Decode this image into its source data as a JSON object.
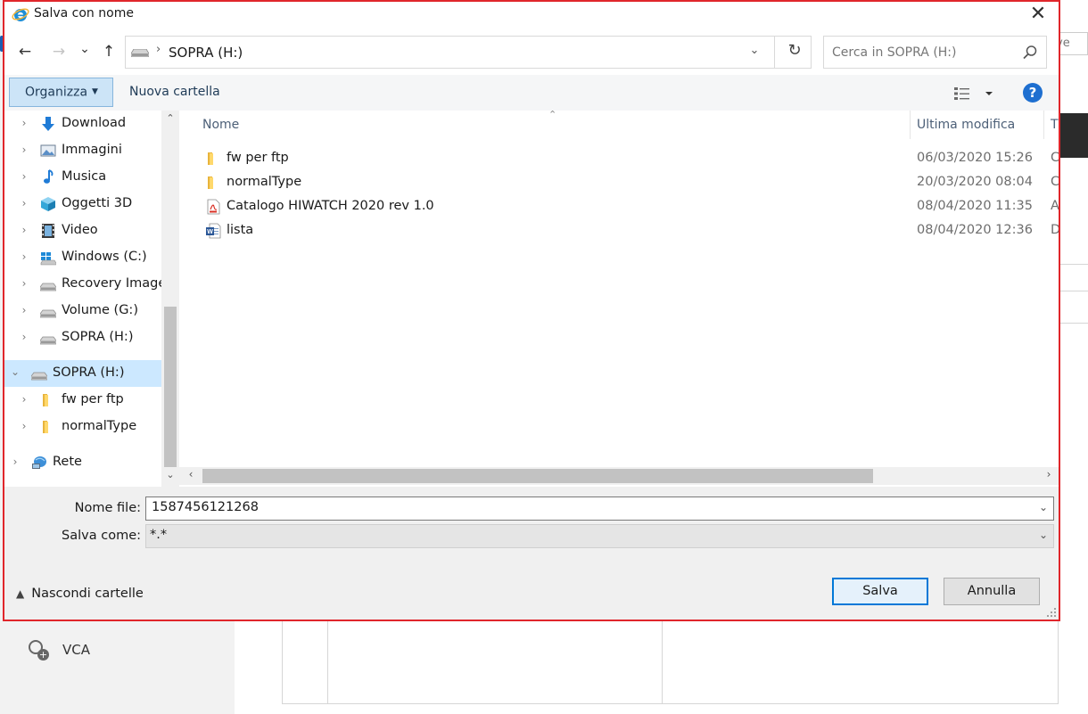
{
  "dialog": {
    "title": "Salva con nome",
    "close_symbol": "✕"
  },
  "nav": {
    "path": "SOPRA (H:)",
    "search_placeholder": "Cerca in SOPRA (H:)",
    "back_symbol": "←",
    "forward_symbol": "→",
    "recent_symbol": "⌄",
    "up_symbol": "↑",
    "dropdown_symbol": "⌄",
    "refresh_symbol": "↻"
  },
  "toolbar": {
    "organize_label": "Organizza",
    "new_folder_label": "Nuova cartella",
    "help_symbol": "?"
  },
  "tree": {
    "items": [
      {
        "label": "Download",
        "icon": "download-icon",
        "expanded": false
      },
      {
        "label": "Immagini",
        "icon": "pictures-icon",
        "expanded": false
      },
      {
        "label": "Musica",
        "icon": "music-icon",
        "expanded": false
      },
      {
        "label": "Oggetti 3D",
        "icon": "3d-objects-icon",
        "expanded": false
      },
      {
        "label": "Video",
        "icon": "video-icon",
        "expanded": false
      },
      {
        "label": "Windows (C:)",
        "icon": "windows-drive-icon",
        "expanded": false
      },
      {
        "label": "Recovery Image",
        "icon": "drive-icon",
        "expanded": false
      },
      {
        "label": "Volume (G:)",
        "icon": "drive-icon",
        "expanded": false
      },
      {
        "label": "SOPRA (H:)",
        "icon": "drive-icon",
        "expanded": false
      },
      {
        "label": "SOPRA (H:)",
        "icon": "drive-icon",
        "expanded": true,
        "selected": true
      },
      {
        "label": "fw per ftp",
        "icon": "folder-icon",
        "expanded": false
      },
      {
        "label": "normalType",
        "icon": "folder-icon",
        "expanded": false
      },
      {
        "label": "Rete",
        "icon": "network-icon",
        "expanded": false
      }
    ]
  },
  "files": {
    "columns": {
      "name": "Nome",
      "modified": "Ultima modifica",
      "type": "Ti"
    },
    "rows": [
      {
        "name": "fw per ftp",
        "date": "06/03/2020 15:26",
        "type": "C",
        "icon": "folder-icon"
      },
      {
        "name": "normalType",
        "date": "20/03/2020 08:04",
        "type": "C",
        "icon": "folder-icon"
      },
      {
        "name": "Catalogo HIWATCH 2020 rev 1.0",
        "date": "08/04/2020 11:35",
        "type": "A",
        "icon": "pdf-icon"
      },
      {
        "name": "lista",
        "date": "08/04/2020 12:36",
        "type": "D",
        "icon": "word-icon"
      }
    ]
  },
  "form": {
    "filename_label": "Nome file:",
    "filename_value": "1587456121268",
    "savetype_label": "Salva come:",
    "savetype_value": "*.*"
  },
  "footer": {
    "hide_folders_label": "Nascondi cartelle",
    "save_label": "Salva",
    "cancel_label": "Annulla"
  },
  "background": {
    "vca_label": "VCA",
    "top_fragment": "ve"
  },
  "colors": {
    "dialog_border": "#e0262b",
    "selection": "#cce8ff",
    "accent": "#0078d7"
  }
}
